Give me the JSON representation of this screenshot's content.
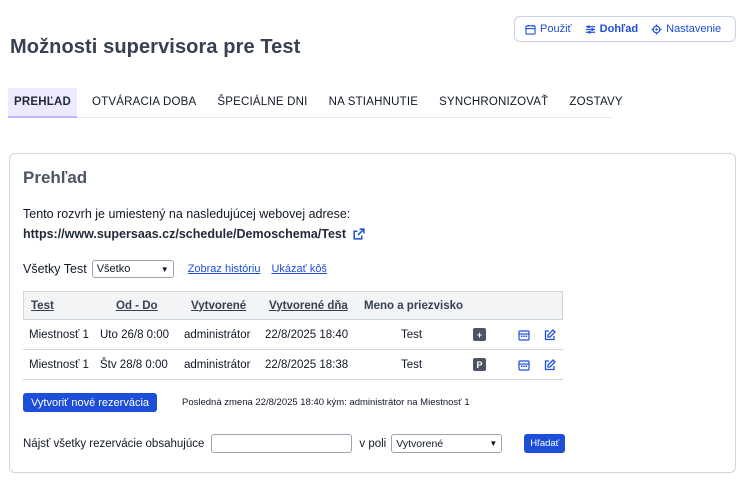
{
  "topnav": {
    "items": [
      {
        "label": "Použiť",
        "icon": "calendar-icon"
      },
      {
        "label": "Dohľad",
        "icon": "sliders-icon"
      },
      {
        "label": "Nastavenie",
        "icon": "gear-icon"
      }
    ]
  },
  "page": {
    "title": "Možnosti supervisora pre Test"
  },
  "tabs": [
    {
      "label": "Prehľad"
    },
    {
      "label": "Otváracia doba"
    },
    {
      "label": "Špeciálne dni"
    },
    {
      "label": "Na stiahnutie"
    },
    {
      "label": "Synchronizovať"
    },
    {
      "label": "Zostavy"
    }
  ],
  "panel": {
    "title": "Prehľad",
    "intro": "Tento rozvrh je umiestený na nasledujúcej webovej adrese:",
    "url": "https://www.supersaas.cz/schedule/Demoschema/Test"
  },
  "filter": {
    "label": "Všetky Test",
    "select_value": "Všetko",
    "history_link": "Zobraz históriu",
    "trash_link": "Ukázať kôš"
  },
  "table": {
    "headers": [
      "Test",
      "Od - Do",
      "Vytvorené",
      "Vytvorené dňa",
      "Meno a priezvisko"
    ],
    "rows": [
      {
        "resource": "Miestnosť 1",
        "time": "Uto 26/8 0:00",
        "created_by": "administrátor",
        "created_on": "22/8/2025 18:40",
        "name": "Test",
        "badge": "+"
      },
      {
        "resource": "Miestnosť 1",
        "time": "Štv 28/8 0:00",
        "created_by": "administrátor",
        "created_on": "22/8/2025 18:38",
        "name": "Test",
        "badge": "P"
      }
    ]
  },
  "actions": {
    "new_button": "Vytvoriť nové rezervácia",
    "last_change": "Posledná zmena 22/8/2025 18:40 kým: administrátor na Miestnosť 1"
  },
  "search": {
    "label": "Nájsť všetky rezervácie obsahujúce",
    "input_value": "",
    "field_label": "v poli",
    "field_select": "Vytvorené",
    "button": "Hľadať"
  },
  "colors": {
    "accent": "#1d4ed8",
    "tab_active_bg": "#ede9fe",
    "badge": "#4b5563"
  }
}
